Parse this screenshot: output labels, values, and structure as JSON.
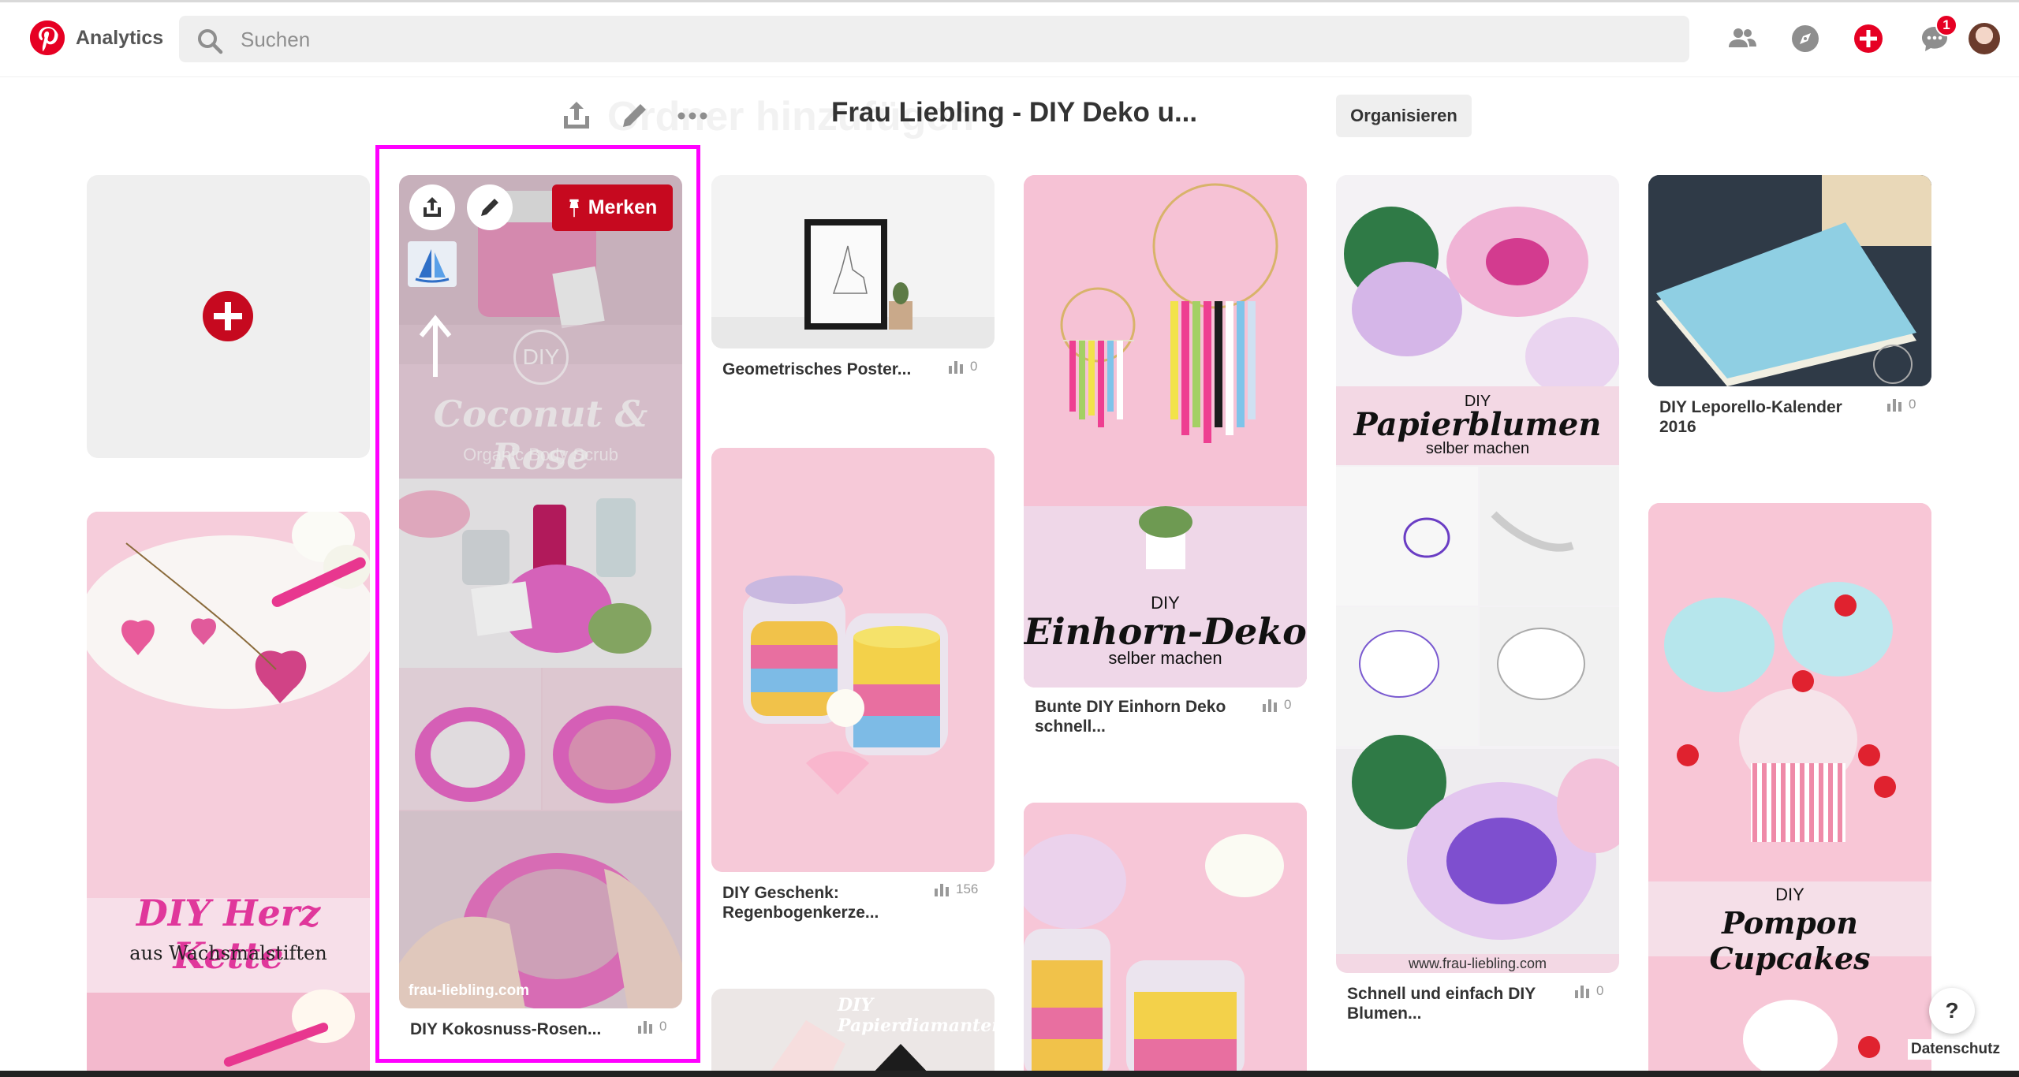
{
  "app": {
    "brand": "Analytics",
    "logo_icon": "pinterest-logo-icon",
    "accent": "#e60023"
  },
  "search": {
    "placeholder": "Suchen"
  },
  "topbar": {
    "notification_count": "1",
    "icons": [
      "people-icon",
      "compass-icon",
      "add-icon",
      "messages-icon",
      "avatar"
    ]
  },
  "board": {
    "title": "Frau Liebling - DIY Deko u...",
    "ghost_text": "Ordner hinzufügen",
    "organize_label": "Organisieren",
    "header_icons": [
      "share-icon",
      "edit-icon",
      "more-icon"
    ]
  },
  "selected_pin": {
    "save_label": "Merken",
    "source": "frau-liebling.com",
    "title": "DIY Kokosnuss-Rosen...",
    "stat": "0",
    "image_text": {
      "diy": "DIY",
      "name": "Coconut & Rose",
      "sub": "Organic Body Scrub"
    }
  },
  "pins": [
    {
      "title": "Geometrisches Poster...",
      "stat": "0"
    },
    {
      "title": "DIY Geschenk: Regenbogenkerze...",
      "stat": "156"
    },
    {
      "title": "Bunte DIY Einhorn Deko schnell...",
      "stat": "0",
      "image_text": {
        "diy": "DIY",
        "name": "Einhorn-Deko",
        "sub": "selber machen"
      }
    },
    {
      "title": "Schnell und einfach DIY Blumen...",
      "stat": "0",
      "image_text": {
        "diy": "DIY",
        "name": "Papierblumen",
        "sub": "selber machen",
        "url": "www.frau-liebling.com"
      }
    },
    {
      "title": "DIY Leporello-Kalender 2016",
      "stat": "0"
    },
    {
      "image_text": {
        "name": "DIY Herz Kette",
        "sub": "aus Wachsmalstiften"
      }
    },
    {
      "image_text": {
        "diy": "DIY",
        "name": "Pompon Cupcakes"
      }
    },
    {
      "image_text": {
        "name": "DIY Papierdiamanten"
      }
    }
  ],
  "footer": {
    "help_label": "?",
    "privacy_label": "Datenschutz"
  },
  "colors": {
    "highlight": "#ff00ff",
    "save_red": "#c6091f",
    "pink_bg": "#f5c6d6"
  }
}
